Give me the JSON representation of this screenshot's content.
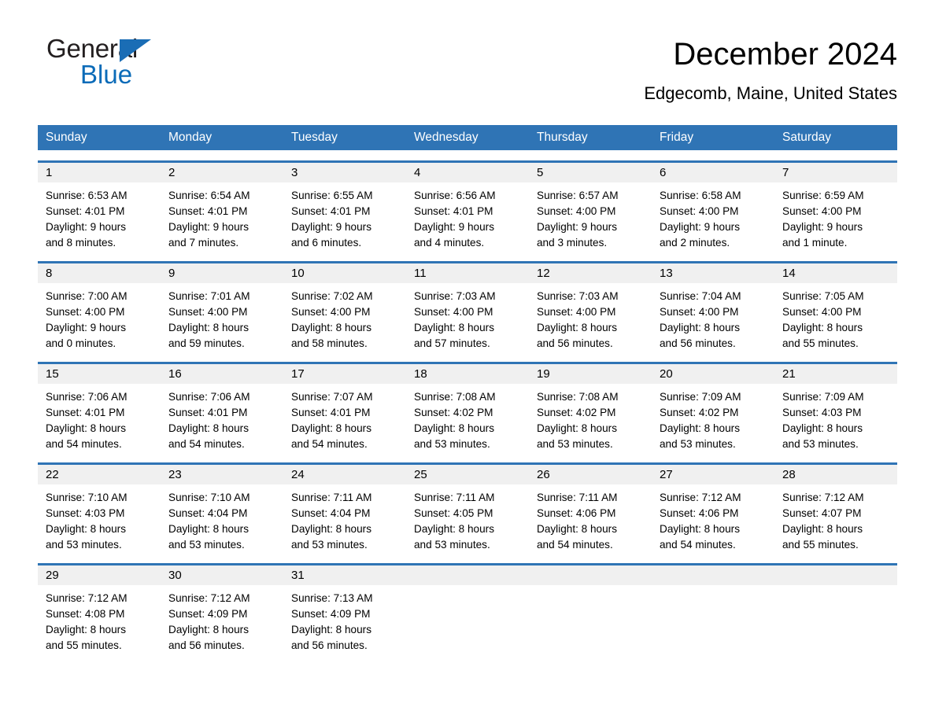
{
  "logo": {
    "word_general": "General",
    "word_blue": "Blue",
    "triangle_color": "#1a6db5"
  },
  "header": {
    "title": "December 2024",
    "subtitle": "Edgecomb, Maine, United States"
  },
  "colors": {
    "header_blue": "#2f74b5",
    "day_band_gray": "#f0f0f0",
    "text": "#000000",
    "logo_blue": "#0b6bb8"
  },
  "weekdays": [
    "Sunday",
    "Monday",
    "Tuesday",
    "Wednesday",
    "Thursday",
    "Friday",
    "Saturday"
  ],
  "weeks": [
    [
      {
        "day": "1",
        "sunrise": "Sunrise: 6:53 AM",
        "sunset": "Sunset: 4:01 PM",
        "daylight1": "Daylight: 9 hours",
        "daylight2": "and 8 minutes."
      },
      {
        "day": "2",
        "sunrise": "Sunrise: 6:54 AM",
        "sunset": "Sunset: 4:01 PM",
        "daylight1": "Daylight: 9 hours",
        "daylight2": "and 7 minutes."
      },
      {
        "day": "3",
        "sunrise": "Sunrise: 6:55 AM",
        "sunset": "Sunset: 4:01 PM",
        "daylight1": "Daylight: 9 hours",
        "daylight2": "and 6 minutes."
      },
      {
        "day": "4",
        "sunrise": "Sunrise: 6:56 AM",
        "sunset": "Sunset: 4:01 PM",
        "daylight1": "Daylight: 9 hours",
        "daylight2": "and 4 minutes."
      },
      {
        "day": "5",
        "sunrise": "Sunrise: 6:57 AM",
        "sunset": "Sunset: 4:00 PM",
        "daylight1": "Daylight: 9 hours",
        "daylight2": "and 3 minutes."
      },
      {
        "day": "6",
        "sunrise": "Sunrise: 6:58 AM",
        "sunset": "Sunset: 4:00 PM",
        "daylight1": "Daylight: 9 hours",
        "daylight2": "and 2 minutes."
      },
      {
        "day": "7",
        "sunrise": "Sunrise: 6:59 AM",
        "sunset": "Sunset: 4:00 PM",
        "daylight1": "Daylight: 9 hours",
        "daylight2": "and 1 minute."
      }
    ],
    [
      {
        "day": "8",
        "sunrise": "Sunrise: 7:00 AM",
        "sunset": "Sunset: 4:00 PM",
        "daylight1": "Daylight: 9 hours",
        "daylight2": "and 0 minutes."
      },
      {
        "day": "9",
        "sunrise": "Sunrise: 7:01 AM",
        "sunset": "Sunset: 4:00 PM",
        "daylight1": "Daylight: 8 hours",
        "daylight2": "and 59 minutes."
      },
      {
        "day": "10",
        "sunrise": "Sunrise: 7:02 AM",
        "sunset": "Sunset: 4:00 PM",
        "daylight1": "Daylight: 8 hours",
        "daylight2": "and 58 minutes."
      },
      {
        "day": "11",
        "sunrise": "Sunrise: 7:03 AM",
        "sunset": "Sunset: 4:00 PM",
        "daylight1": "Daylight: 8 hours",
        "daylight2": "and 57 minutes."
      },
      {
        "day": "12",
        "sunrise": "Sunrise: 7:03 AM",
        "sunset": "Sunset: 4:00 PM",
        "daylight1": "Daylight: 8 hours",
        "daylight2": "and 56 minutes."
      },
      {
        "day": "13",
        "sunrise": "Sunrise: 7:04 AM",
        "sunset": "Sunset: 4:00 PM",
        "daylight1": "Daylight: 8 hours",
        "daylight2": "and 56 minutes."
      },
      {
        "day": "14",
        "sunrise": "Sunrise: 7:05 AM",
        "sunset": "Sunset: 4:00 PM",
        "daylight1": "Daylight: 8 hours",
        "daylight2": "and 55 minutes."
      }
    ],
    [
      {
        "day": "15",
        "sunrise": "Sunrise: 7:06 AM",
        "sunset": "Sunset: 4:01 PM",
        "daylight1": "Daylight: 8 hours",
        "daylight2": "and 54 minutes."
      },
      {
        "day": "16",
        "sunrise": "Sunrise: 7:06 AM",
        "sunset": "Sunset: 4:01 PM",
        "daylight1": "Daylight: 8 hours",
        "daylight2": "and 54 minutes."
      },
      {
        "day": "17",
        "sunrise": "Sunrise: 7:07 AM",
        "sunset": "Sunset: 4:01 PM",
        "daylight1": "Daylight: 8 hours",
        "daylight2": "and 54 minutes."
      },
      {
        "day": "18",
        "sunrise": "Sunrise: 7:08 AM",
        "sunset": "Sunset: 4:02 PM",
        "daylight1": "Daylight: 8 hours",
        "daylight2": "and 53 minutes."
      },
      {
        "day": "19",
        "sunrise": "Sunrise: 7:08 AM",
        "sunset": "Sunset: 4:02 PM",
        "daylight1": "Daylight: 8 hours",
        "daylight2": "and 53 minutes."
      },
      {
        "day": "20",
        "sunrise": "Sunrise: 7:09 AM",
        "sunset": "Sunset: 4:02 PM",
        "daylight1": "Daylight: 8 hours",
        "daylight2": "and 53 minutes."
      },
      {
        "day": "21",
        "sunrise": "Sunrise: 7:09 AM",
        "sunset": "Sunset: 4:03 PM",
        "daylight1": "Daylight: 8 hours",
        "daylight2": "and 53 minutes."
      }
    ],
    [
      {
        "day": "22",
        "sunrise": "Sunrise: 7:10 AM",
        "sunset": "Sunset: 4:03 PM",
        "daylight1": "Daylight: 8 hours",
        "daylight2": "and 53 minutes."
      },
      {
        "day": "23",
        "sunrise": "Sunrise: 7:10 AM",
        "sunset": "Sunset: 4:04 PM",
        "daylight1": "Daylight: 8 hours",
        "daylight2": "and 53 minutes."
      },
      {
        "day": "24",
        "sunrise": "Sunrise: 7:11 AM",
        "sunset": "Sunset: 4:04 PM",
        "daylight1": "Daylight: 8 hours",
        "daylight2": "and 53 minutes."
      },
      {
        "day": "25",
        "sunrise": "Sunrise: 7:11 AM",
        "sunset": "Sunset: 4:05 PM",
        "daylight1": "Daylight: 8 hours",
        "daylight2": "and 53 minutes."
      },
      {
        "day": "26",
        "sunrise": "Sunrise: 7:11 AM",
        "sunset": "Sunset: 4:06 PM",
        "daylight1": "Daylight: 8 hours",
        "daylight2": "and 54 minutes."
      },
      {
        "day": "27",
        "sunrise": "Sunrise: 7:12 AM",
        "sunset": "Sunset: 4:06 PM",
        "daylight1": "Daylight: 8 hours",
        "daylight2": "and 54 minutes."
      },
      {
        "day": "28",
        "sunrise": "Sunrise: 7:12 AM",
        "sunset": "Sunset: 4:07 PM",
        "daylight1": "Daylight: 8 hours",
        "daylight2": "and 55 minutes."
      }
    ],
    [
      {
        "day": "29",
        "sunrise": "Sunrise: 7:12 AM",
        "sunset": "Sunset: 4:08 PM",
        "daylight1": "Daylight: 8 hours",
        "daylight2": "and 55 minutes."
      },
      {
        "day": "30",
        "sunrise": "Sunrise: 7:12 AM",
        "sunset": "Sunset: 4:09 PM",
        "daylight1": "Daylight: 8 hours",
        "daylight2": "and 56 minutes."
      },
      {
        "day": "31",
        "sunrise": "Sunrise: 7:13 AM",
        "sunset": "Sunset: 4:09 PM",
        "daylight1": "Daylight: 8 hours",
        "daylight2": "and 56 minutes."
      },
      {
        "day": "",
        "sunrise": "",
        "sunset": "",
        "daylight1": "",
        "daylight2": ""
      },
      {
        "day": "",
        "sunrise": "",
        "sunset": "",
        "daylight1": "",
        "daylight2": ""
      },
      {
        "day": "",
        "sunrise": "",
        "sunset": "",
        "daylight1": "",
        "daylight2": ""
      },
      {
        "day": "",
        "sunrise": "",
        "sunset": "",
        "daylight1": "",
        "daylight2": ""
      }
    ]
  ]
}
